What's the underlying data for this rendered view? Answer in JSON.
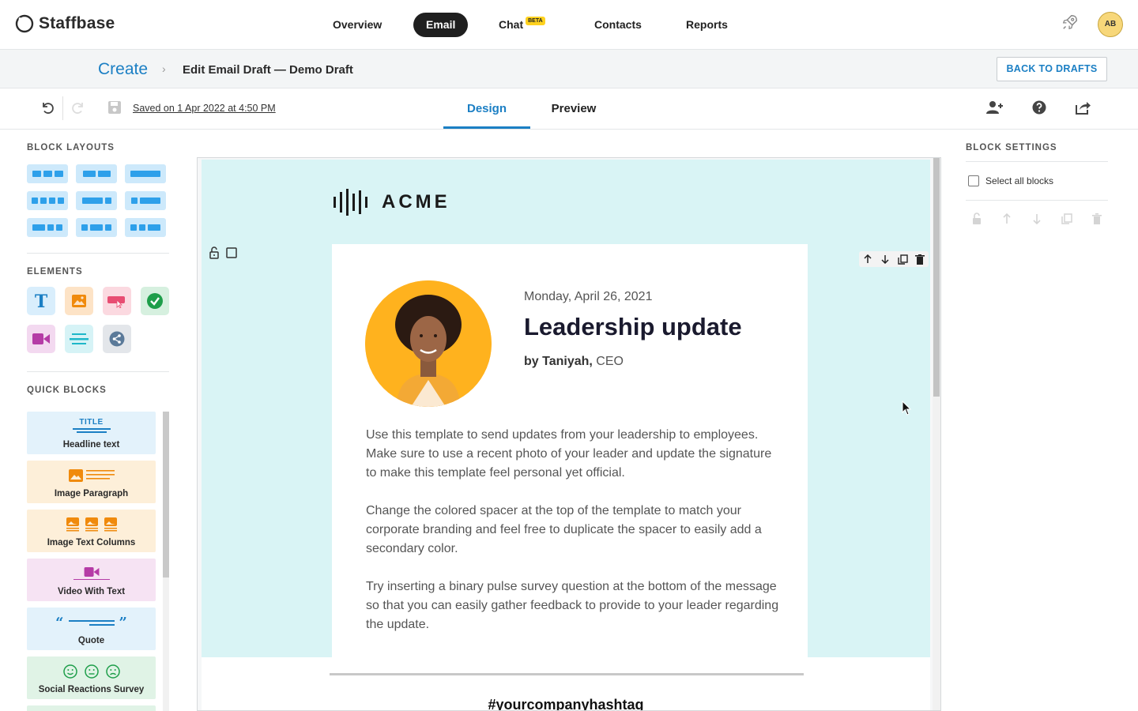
{
  "app": {
    "brand": "Staffbase",
    "avatar_initials": "AB",
    "accent_color": "#1b7fc4"
  },
  "nav": {
    "items": [
      {
        "label": "Overview"
      },
      {
        "label": "Email"
      },
      {
        "label": "Chat"
      },
      {
        "label": "Contacts"
      },
      {
        "label": "Reports"
      }
    ],
    "active": "Email",
    "chat_badge": "BETA"
  },
  "breadcrumb": {
    "root": "Create",
    "separator": "›",
    "current": "Edit Email Draft — Demo Draft",
    "back_button": "BACK TO DRAFTS"
  },
  "toolbar": {
    "saved_text": "Saved on 1 Apr 2022 at 4:50 PM",
    "tabs": [
      {
        "label": "Design"
      },
      {
        "label": "Preview"
      }
    ],
    "active_tab": "Design",
    "icons": [
      "undo-icon",
      "redo-icon",
      "save-icon",
      "add-user-icon",
      "help-icon",
      "share-icon"
    ]
  },
  "left_panel": {
    "block_layouts_title": "BLOCK LAYOUTS",
    "elements_title": "ELEMENTS",
    "elements": [
      "text-element-icon",
      "image-element-icon",
      "button-element-icon",
      "survey-element-icon",
      "video-element-icon",
      "divider-element-icon",
      "social-element-icon"
    ],
    "quick_blocks_title": "QUICK BLOCKS",
    "quick_blocks": [
      {
        "label": "Headline text",
        "icon_text": "TITLE",
        "color": "#e3f2fb"
      },
      {
        "label": "Image Paragraph",
        "color": "#fdefd9"
      },
      {
        "label": "Image Text Columns",
        "color": "#fdefd9"
      },
      {
        "label": "Video With Text",
        "color": "#f6e3f3"
      },
      {
        "label": "Quote",
        "color": "#e3f2fb"
      },
      {
        "label": "Social Reactions Survey",
        "color": "#e0f3e6"
      }
    ]
  },
  "email": {
    "brand_logo_text": "ACME",
    "date": "Monday, April 26, 2021",
    "headline": "Leadership update",
    "byline_name": "by Taniyah,",
    "byline_role": " CEO",
    "paragraphs": [
      "Use this template to send updates from your leadership to employees. Make sure to use a recent photo of your leader and update the signature to make this template feel personal yet official.",
      "Change the colored spacer at the top of the template to match your corporate branding and feel free to duplicate the spacer to easily add a secondary color.",
      "Try inserting a binary pulse survey question at the bottom of the message so that you can easily gather feedback to provide to your leader regarding the update."
    ],
    "hashtag": "#yourcompanyhashtag",
    "header_bg": "#d9f4f5"
  },
  "right_panel": {
    "title": "BLOCK SETTINGS",
    "select_all_label": "Select all blocks"
  }
}
